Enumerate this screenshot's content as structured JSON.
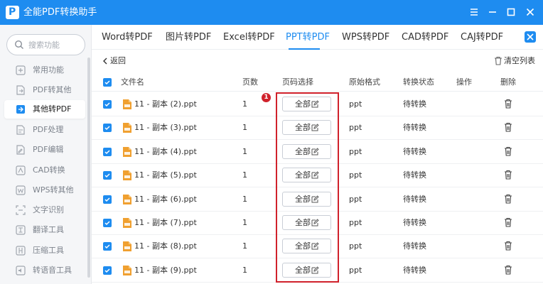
{
  "window": {
    "app_title": "全能PDF转换助手",
    "logo_letter": "P"
  },
  "sidebar": {
    "search_placeholder": "搜索功能",
    "items": [
      {
        "label": "常用功能",
        "icon": "star-icon",
        "active": false
      },
      {
        "label": "PDF转其他",
        "icon": "file-export-icon",
        "active": false
      },
      {
        "label": "其他转PDF",
        "icon": "file-import-icon",
        "active": true
      },
      {
        "label": "PDF处理",
        "icon": "file-edit-icon",
        "active": false
      },
      {
        "label": "PDF编辑",
        "icon": "pencil-icon",
        "active": false
      },
      {
        "label": "CAD转换",
        "icon": "cad-icon",
        "active": false
      },
      {
        "label": "WPS转其他",
        "icon": "wps-icon",
        "active": false
      },
      {
        "label": "文字识别",
        "icon": "ocr-icon",
        "active": false
      },
      {
        "label": "翻译工具",
        "icon": "translate-icon",
        "active": false
      },
      {
        "label": "压缩工具",
        "icon": "compress-icon",
        "active": false
      },
      {
        "label": "转语音工具",
        "icon": "speaker-icon",
        "active": false
      }
    ]
  },
  "tabs": [
    {
      "label": "Word转PDF",
      "active": false
    },
    {
      "label": "图片转PDF",
      "active": false
    },
    {
      "label": "Excel转PDF",
      "active": false
    },
    {
      "label": "PPT转PDF",
      "active": true
    },
    {
      "label": "WPS转PDF",
      "active": false
    },
    {
      "label": "CAD转PDF",
      "active": false
    },
    {
      "label": "CAJ转PDF",
      "active": false
    }
  ],
  "toolbar": {
    "back_label": "返回",
    "clear_label": "清空列表"
  },
  "table": {
    "headers": {
      "filename": "文件名",
      "pages": "页数",
      "page_select": "页码选择",
      "format": "原始格式",
      "status": "转换状态",
      "action": "操作",
      "delete": "删除"
    },
    "rows": [
      {
        "filename": "11 - 副本 (2).ppt",
        "pages": "1",
        "page_select": "全部",
        "format": "ppt",
        "status": "待转换",
        "checked": true
      },
      {
        "filename": "11 - 副本 (3).ppt",
        "pages": "1",
        "page_select": "全部",
        "format": "ppt",
        "status": "待转换",
        "checked": true
      },
      {
        "filename": "11 - 副本 (4).ppt",
        "pages": "1",
        "page_select": "全部",
        "format": "ppt",
        "status": "待转换",
        "checked": true
      },
      {
        "filename": "11 - 副本 (5).ppt",
        "pages": "1",
        "page_select": "全部",
        "format": "ppt",
        "status": "待转换",
        "checked": true
      },
      {
        "filename": "11 - 副本 (6).ppt",
        "pages": "1",
        "page_select": "全部",
        "format": "ppt",
        "status": "待转换",
        "checked": true
      },
      {
        "filename": "11 - 副本 (7).ppt",
        "pages": "1",
        "page_select": "全部",
        "format": "ppt",
        "status": "待转换",
        "checked": true
      },
      {
        "filename": "11 - 副本 (8).ppt",
        "pages": "1",
        "page_select": "全部",
        "format": "ppt",
        "status": "待转换",
        "checked": true
      },
      {
        "filename": "11 - 副本 (9).ppt",
        "pages": "1",
        "page_select": "全部",
        "format": "ppt",
        "status": "待转换",
        "checked": true
      }
    ]
  },
  "annotation": {
    "badge": "1"
  },
  "colors": {
    "accent": "#1e8cf0",
    "annotation_red": "#d0212b",
    "file_icon": "#f0a030"
  }
}
